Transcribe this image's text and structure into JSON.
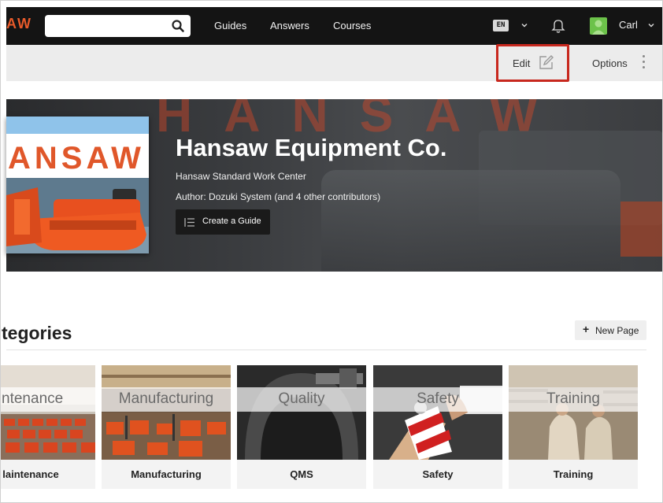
{
  "nav": {
    "brand": "AW",
    "search_placeholder": "",
    "links": [
      "Guides",
      "Answers",
      "Courses"
    ],
    "language": "EN",
    "user": "Carl",
    "icons": [
      "search-icon",
      "chevron-down-icon",
      "bell-icon",
      "avatar"
    ]
  },
  "toolbar": {
    "edit_label": "Edit",
    "options_label": "Options",
    "highlight_color": "#c8281e"
  },
  "hero": {
    "image_brand_text": "ANSAW",
    "title": "Hansaw Equipment Co.",
    "subtitle": "Hansaw Standard Work Center",
    "author": "Author: Dozuki System (and 4 other contributors)",
    "create_button": "Create a Guide"
  },
  "categories": {
    "heading": "tegories",
    "new_page_label": "New Page",
    "items": [
      {
        "overlay": "intenance",
        "label": "laintenance"
      },
      {
        "overlay": "Manufacturing",
        "label": "Manufacturing"
      },
      {
        "overlay": "Quality",
        "label": "QMS"
      },
      {
        "overlay": "Safety",
        "label": "Safety"
      },
      {
        "overlay": "Training",
        "label": "Training"
      }
    ]
  },
  "colors": {
    "nav_bg": "#141414",
    "brand_accent": "#e85a2a",
    "toolbar_bg": "#ececec"
  }
}
